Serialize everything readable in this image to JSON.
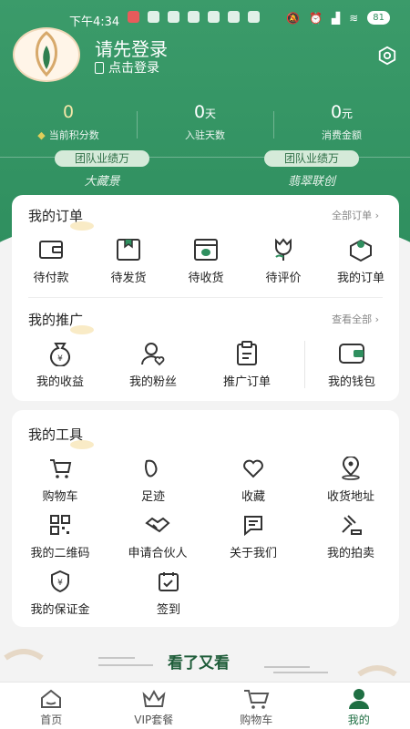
{
  "status_bar": {
    "time": "下午4:34",
    "battery": "81"
  },
  "profile": {
    "title": "请先登录",
    "subtitle": "点击登录"
  },
  "stats": [
    {
      "value": "0",
      "unit": "",
      "label": "当前积分数"
    },
    {
      "value": "0",
      "unit": "天",
      "label": "入驻天数"
    },
    {
      "value": "0",
      "unit": "元",
      "label": "消费金额"
    }
  ],
  "teams": [
    {
      "badge": "团队业绩万",
      "name": "大藏景"
    },
    {
      "badge": "团队业绩万",
      "name": "翡翠联创"
    }
  ],
  "orders": {
    "title": "我的订单",
    "more": "全部订单",
    "items": [
      "待付款",
      "待发货",
      "待收货",
      "待评价",
      "我的订单"
    ]
  },
  "promotion": {
    "title": "我的推广",
    "more": "查看全部",
    "items": [
      "我的收益",
      "我的粉丝",
      "推广订单",
      "我的钱包"
    ]
  },
  "tools": {
    "title": "我的工具",
    "items": [
      "购物车",
      "足迹",
      "收藏",
      "收货地址",
      "我的二维码",
      "申请合伙人",
      "关于我们",
      "我的拍卖",
      "我的保证金",
      "签到"
    ]
  },
  "watch_again": "看了又看",
  "tabbar": [
    "首页",
    "VIP套餐",
    "购物车",
    "我的"
  ],
  "colors": {
    "primary": "#2f8f5f",
    "active": "#1f6f43"
  }
}
